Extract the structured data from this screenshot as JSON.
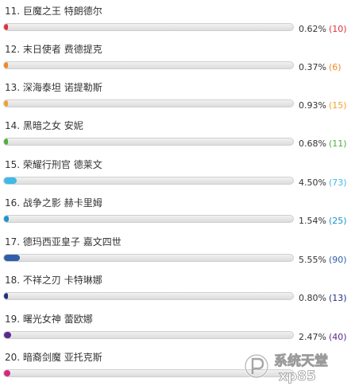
{
  "poll": {
    "items": [
      {
        "label": "11. 巨魔之王 特朗德尔",
        "percent": "0.62%",
        "count": "(10)",
        "fill_fraction": 0.0062,
        "color": "#e0313b"
      },
      {
        "label": "12. 末日使者 费德提克",
        "percent": "0.37%",
        "count": "(6)",
        "fill_fraction": 0.0037,
        "color": "#ee8a21"
      },
      {
        "label": "13. 深海泰坦 诺提勒斯",
        "percent": "0.93%",
        "count": "(15)",
        "fill_fraction": 0.0093,
        "color": "#f0a22a"
      },
      {
        "label": "14. 黑暗之女 安妮",
        "percent": "0.68%",
        "count": "(11)",
        "fill_fraction": 0.0068,
        "color": "#4fae3c"
      },
      {
        "label": "15. 荣耀行刑官 德莱文",
        "percent": "4.50%",
        "count": "(73)",
        "fill_fraction": 0.045,
        "color": "#3fb9e8"
      },
      {
        "label": "16. 战争之影 赫卡里姆",
        "percent": "1.54%",
        "count": "(25)",
        "fill_fraction": 0.0154,
        "color": "#1b93cf"
      },
      {
        "label": "17. 德玛西亚皇子 嘉文四世",
        "percent": "5.55%",
        "count": "(90)",
        "fill_fraction": 0.0555,
        "color": "#2f5fa9"
      },
      {
        "label": "18. 不祥之刃 卡特琳娜",
        "percent": "0.80%",
        "count": "(13)",
        "fill_fraction": 0.008,
        "color": "#22307d"
      },
      {
        "label": "19. 曙光女神 蕾欧娜",
        "percent": "2.47%",
        "count": "(40)",
        "fill_fraction": 0.0247,
        "color": "#5a2a8c"
      },
      {
        "label": "20. 暗裔剑魔 亚托克斯",
        "percent": "",
        "count": "",
        "fill_fraction": 0.0222,
        "color": "#d6287f"
      }
    ]
  },
  "watermark": {
    "text": "系统天堂",
    "sub_text": "xp85",
    "logo_icon": "p-circle-icon"
  }
}
